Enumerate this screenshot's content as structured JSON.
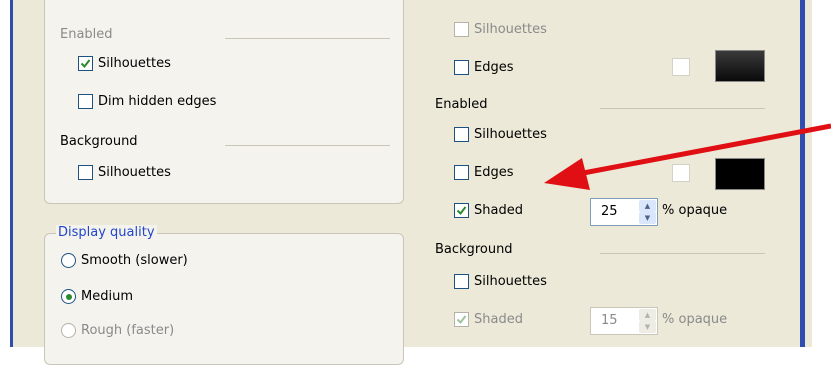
{
  "left": {
    "enabled_heading": "Enabled",
    "enabled_silhouettes": "Silhouettes",
    "dim_hidden_edges": "Dim hidden edges",
    "background_heading": "Background",
    "background_silhouettes": "Silhouettes",
    "display_quality": {
      "legend": "Display quality",
      "smooth": "Smooth (slower)",
      "medium": "Medium",
      "rough": "Rough (faster)",
      "selected": "Medium"
    }
  },
  "right": {
    "top_silhouettes": "Silhouettes",
    "top_edges": "Edges",
    "enabled_heading": "Enabled",
    "enabled_silhouettes": "Silhouettes",
    "enabled_edges": "Edges",
    "enabled_shaded": "Shaded",
    "enabled_opacity": "25",
    "enabled_opacity_unit": "% opaque",
    "background_heading": "Background",
    "background_silhouettes": "Silhouettes",
    "background_shaded": "Shaded",
    "background_opacity": "15",
    "background_opacity_unit": "% opaque"
  },
  "colors": {
    "accent_red": "#e00f14",
    "window_frame_blue": "#2f4fb0",
    "check_green": "#2b8a2b",
    "swatch_black_top": "#101010",
    "swatch_black_mid": "#000000"
  },
  "annotation": {
    "arrow_color": "#e00f14",
    "points_to": "Edges"
  }
}
